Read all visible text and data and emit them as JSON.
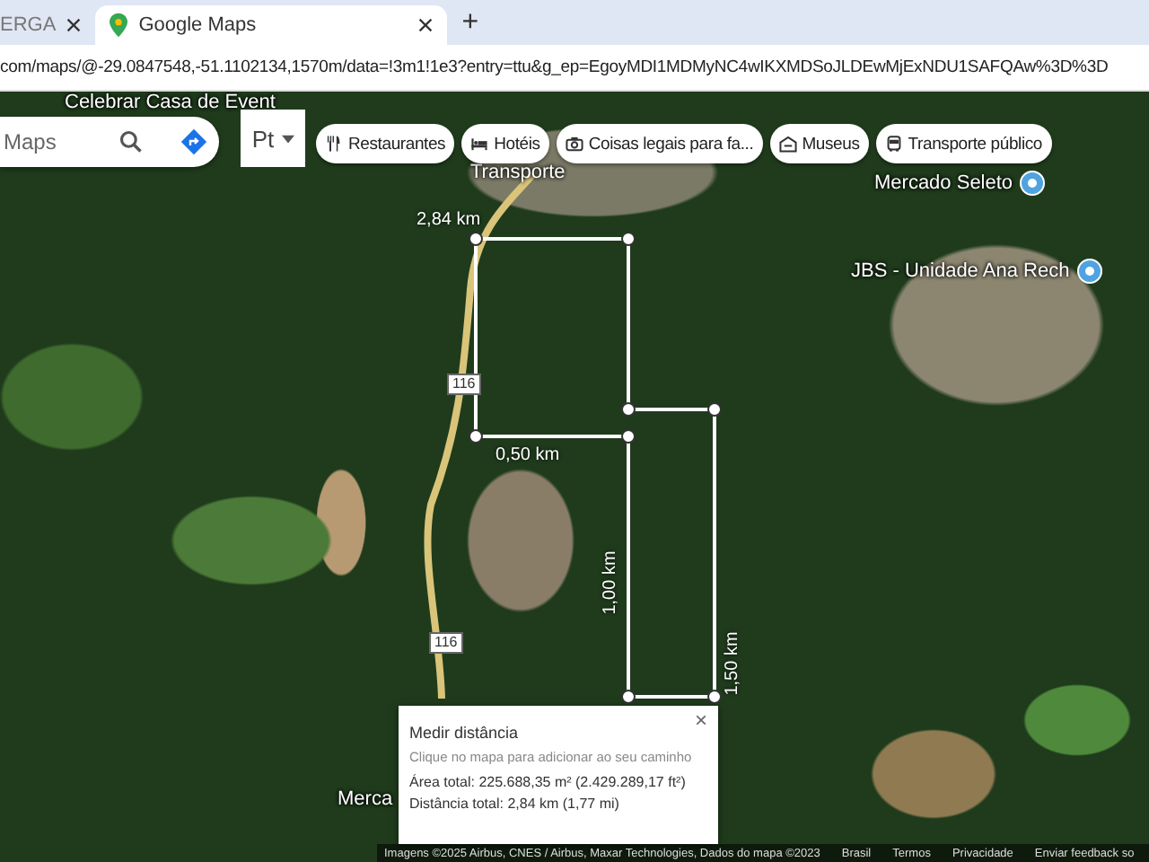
{
  "tabs": [
    {
      "label": "ERGA",
      "selected": false
    },
    {
      "label": "Google Maps",
      "selected": true
    }
  ],
  "new_tab": "+",
  "url": "com/maps/@-29.0847548,-51.1102134,1570m/data=!3m1!1e3?entry=ttu&g_ep=EgoyMDI1MDMyNC4wIKXMDSoJLDEwMjExNDU1SAFQAw%3D%3D",
  "search": {
    "placeholder": "Maps"
  },
  "layer_button": "Pt",
  "chips": [
    {
      "label": "Restaurantes"
    },
    {
      "label": "Hotéis"
    },
    {
      "label": "Coisas legais para fa..."
    },
    {
      "label": "Museus"
    },
    {
      "label": "Transporte público"
    }
  ],
  "map": {
    "places": [
      {
        "text": "Celebrar Casa de Event",
        "pin": false
      },
      {
        "text": "Transporte",
        "pin": false
      },
      {
        "text": "Mercado Seleto",
        "pin": true
      },
      {
        "text": "JBS - Unidade Ana Rech",
        "pin": true
      },
      {
        "text": "Merca",
        "pin": false
      }
    ],
    "road_labels": [
      "116",
      "116"
    ],
    "measurements": [
      "2,84 km",
      "0,50 km",
      "1,00 km",
      "1,50 km"
    ]
  },
  "measure_panel": {
    "title": "Medir distância",
    "hint": "Clique no mapa para adicionar ao seu caminho",
    "area": "Área total: 225.688,35 m² (2.429.289,17 ft²)",
    "distance": "Distância total: 2,84 km (1,77 mi)",
    "close": "×"
  },
  "footer": {
    "attribution": "Imagens ©2025 Airbus, CNES / Airbus, Maxar Technologies, Dados do mapa ©2023",
    "links": [
      "Brasil",
      "Termos",
      "Privacidade",
      "Enviar feedback so"
    ]
  }
}
